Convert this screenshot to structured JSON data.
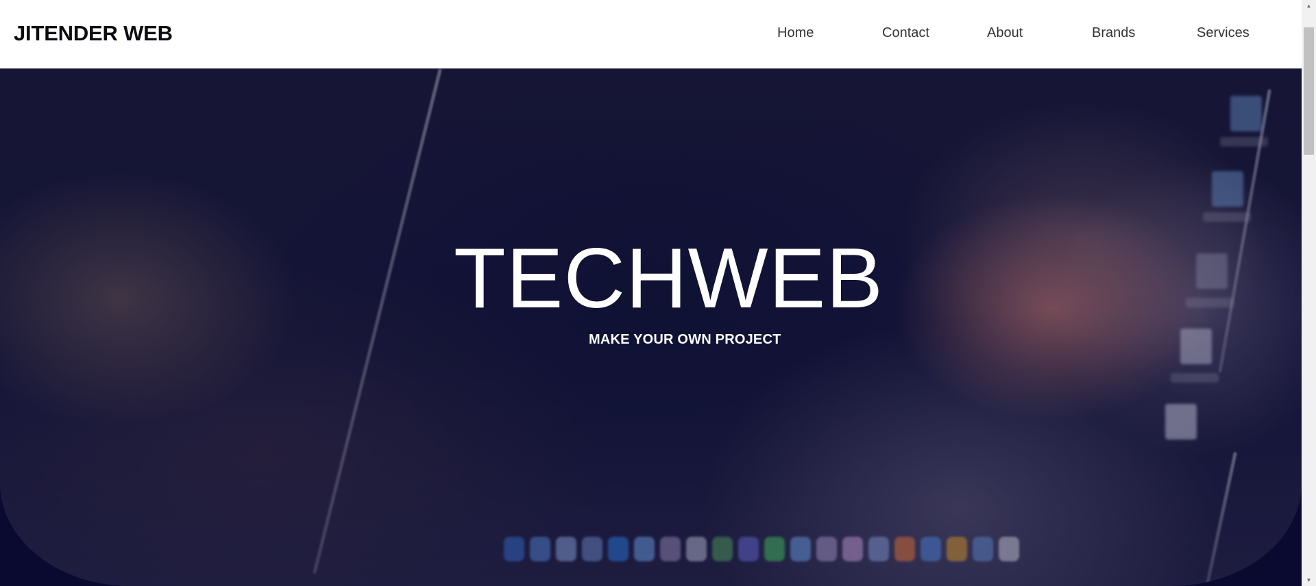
{
  "header": {
    "brand": "JITENDER WEB",
    "nav": [
      {
        "label": "Home"
      },
      {
        "label": "Contact"
      },
      {
        "label": "About"
      },
      {
        "label": "Brands"
      },
      {
        "label": "Services"
      }
    ]
  },
  "hero": {
    "title": "TECHWEB",
    "subtitle": "MAKE YOUR OWN PROJECT"
  },
  "scrollbar": {
    "up_icon": "up-arrow-icon",
    "down_icon": "down-arrow-icon"
  },
  "colors": {
    "header_bg": "#ffffff",
    "brand_text": "#0c0c12",
    "nav_text": "#333333",
    "hero_overlay": "#0a0930",
    "hero_text": "#ffffff"
  }
}
